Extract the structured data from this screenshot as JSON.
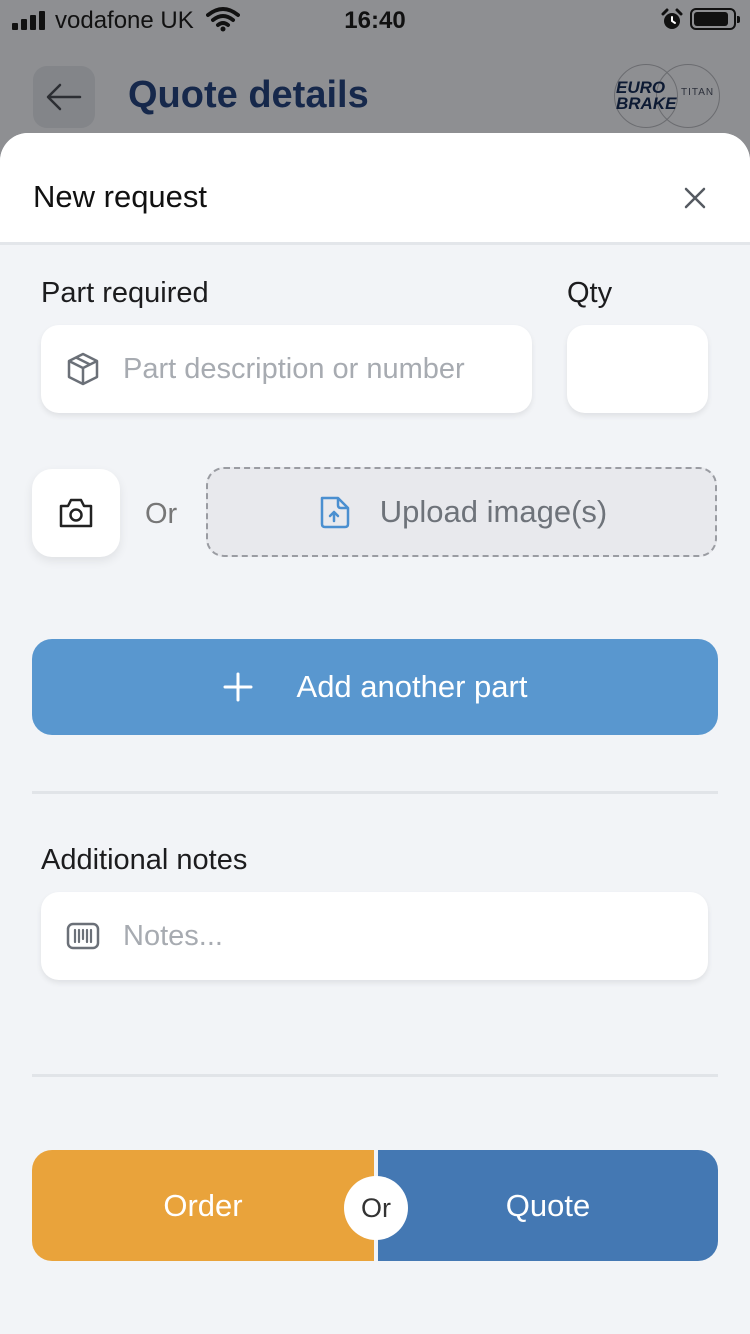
{
  "status_bar": {
    "carrier": "vodafone UK",
    "time": "16:40",
    "battery_level": 0.9
  },
  "header": {
    "title": "Quote details",
    "logo_text_primary": "EURO BRAKE",
    "logo_text_secondary": "TITAN"
  },
  "sheet": {
    "title": "New request",
    "part": {
      "label": "Part required",
      "placeholder": "Part description or number",
      "value": ""
    },
    "qty": {
      "label": "Qty",
      "value": ""
    },
    "or_label": "Or",
    "upload_label": "Upload image(s)",
    "add_part_label": "Add another part",
    "notes": {
      "label": "Additional notes",
      "placeholder": "Notes...",
      "value": ""
    },
    "order_label": "Order",
    "quote_label": "Quote",
    "choice_separator": "Or"
  },
  "icons": {
    "back": "arrow-left-icon",
    "close": "close-icon",
    "part": "package-box-icon",
    "camera": "camera-icon",
    "upload": "file-upload-icon",
    "add": "plus-icon",
    "notes": "barcode-icon"
  },
  "colors": {
    "accent_blue": "#5997cf",
    "order_orange": "#e9a33b",
    "quote_blue": "#4478b3",
    "title_navy": "#16284b"
  }
}
